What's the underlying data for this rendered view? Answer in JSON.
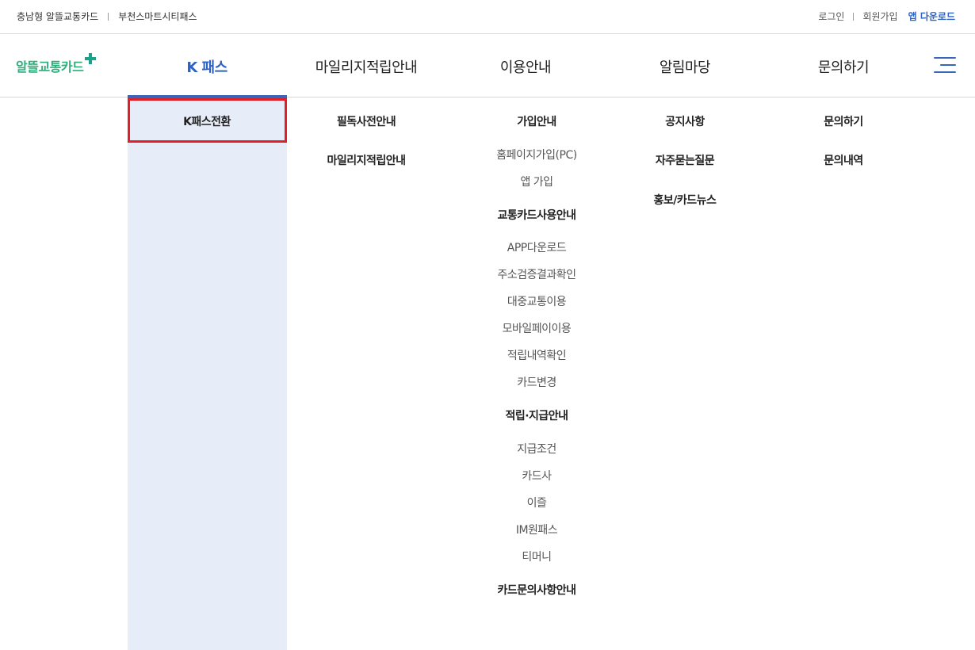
{
  "topbar": {
    "left_links": [
      "충남형 알뜰교통카드",
      "부천스마트시티패스"
    ],
    "login": "로그인",
    "signup": "회원가입",
    "app_download": "앱 다운로드"
  },
  "logo": {
    "text": "알뜰교통카드",
    "icon": "plus-icon",
    "color": "#2fae7c"
  },
  "gnb": {
    "items": [
      "K 패스",
      "마일리지적립안내",
      "이용안내",
      "알림마당",
      "문의하기"
    ],
    "active_index": 0,
    "accent_color": "#2e63c6"
  },
  "menu_icon": "hamburger-menu-icon",
  "dropdown": {
    "col1": {
      "items": [
        "K패스전환"
      ]
    },
    "col2": {
      "items": [
        "필독사전안내",
        "마일리지적립안내"
      ]
    },
    "col3": {
      "groups": [
        {
          "title": "가입안내",
          "items": [
            "홈페이지가입(PC)",
            "앱 가입"
          ]
        },
        {
          "title": "교통카드사용안내",
          "items": [
            "APP다운로드",
            "주소검증결과확인",
            "대중교통이용",
            "모바일페이이용",
            "적립내역확인",
            "카드변경"
          ]
        },
        {
          "title": "적립·지급안내",
          "items": [
            "지급조건",
            "카드사",
            "이즐",
            "IM원패스",
            "티머니"
          ]
        },
        {
          "title": "카드문의사항안내",
          "items": []
        }
      ]
    },
    "col4": {
      "items": [
        "공지사항",
        "자주묻는질문",
        "홍보/카드뉴스"
      ]
    },
    "col5": {
      "items": [
        "문의하기",
        "문의내역"
      ]
    }
  },
  "colors": {
    "highlight_border": "#e01f26",
    "active_column_bg": "#e6edf8"
  }
}
